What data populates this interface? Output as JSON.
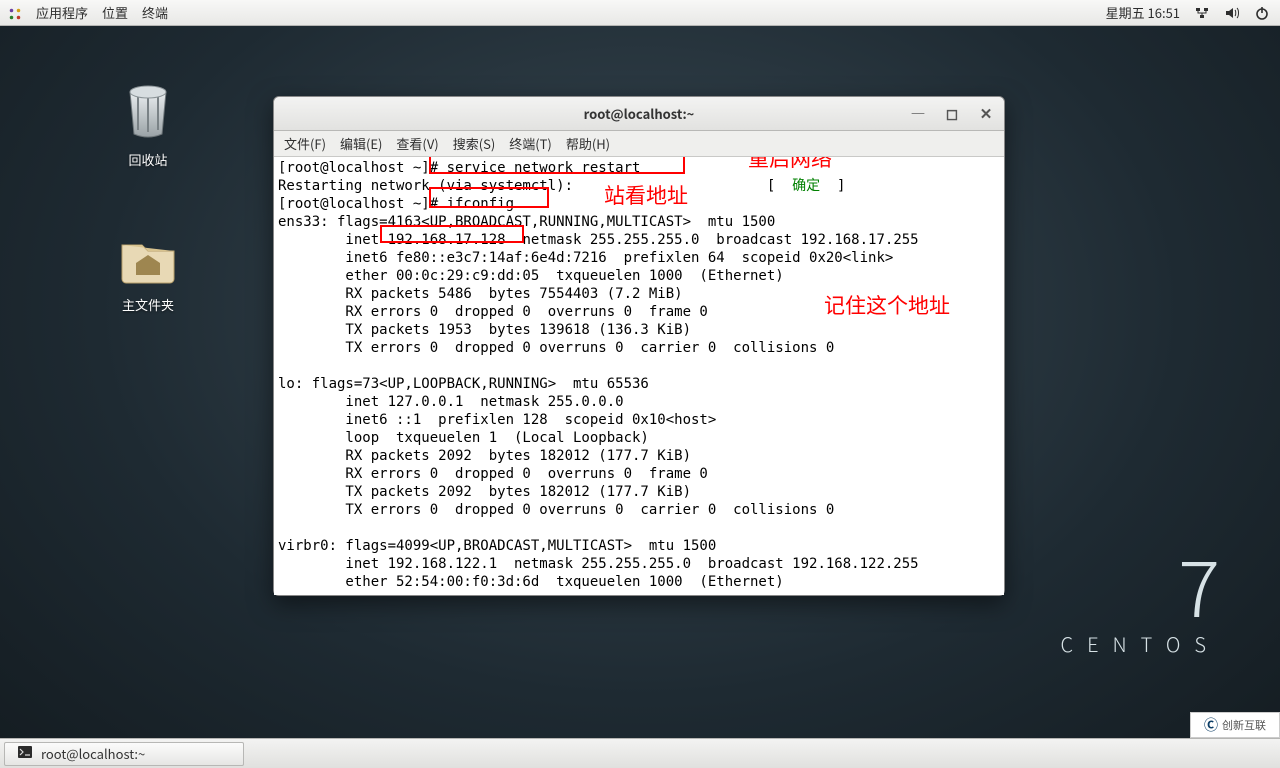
{
  "topbar": {
    "menus": [
      "应用程序",
      "位置",
      "终端"
    ],
    "clock": "星期五 16:51"
  },
  "desktop": {
    "trash_label": "回收站",
    "home_label": "主文件夹"
  },
  "centos": {
    "seven": "7",
    "word": "CENTOS"
  },
  "taskbar": {
    "task_label": "root@localhost:~"
  },
  "window": {
    "title": "root@localhost:~",
    "menus": [
      "文件(F)",
      "编辑(E)",
      "查看(V)",
      "搜索(S)",
      "终端(T)",
      "帮助(H)"
    ]
  },
  "annotations": {
    "restart": "重启网络",
    "view_ip": "站看地址",
    "remember": "记住这个地址",
    "ok": "确定"
  },
  "terminal": {
    "line1_prompt": "[root@localhost ~]",
    "line1_cmd": "# service network restart",
    "line2_a": "Restarting network (via systemctl):",
    "line2_b": "                       [  ",
    "line2_c": "  ]",
    "line3_prompt": "[root@localhost ~]",
    "line3_cmd": "# ifconfig",
    "ens_head": "ens33: flags=4163<UP,BROADCAST,RUNNING,MULTICAST>  mtu 1500",
    "ens_inet_a": "        inet ",
    "ens_inet_ip": "192.168.17.128",
    "ens_inet_b": "  netmask 255.255.255.0  broadcast 192.168.17.255",
    "ens_inet6": "        inet6 fe80::e3c7:14af:6e4d:7216  prefixlen 64  scopeid 0x20<link>",
    "ens_ether": "        ether 00:0c:29:c9:dd:05  txqueuelen 1000  (Ethernet)",
    "ens_rx1": "        RX packets 5486  bytes 7554403 (7.2 MiB)",
    "ens_rx2": "        RX errors 0  dropped 0  overruns 0  frame 0",
    "ens_tx1": "        TX packets 1953  bytes 139618 (136.3 KiB)",
    "ens_tx2": "        TX errors 0  dropped 0 overruns 0  carrier 0  collisions 0",
    "lo_head": "lo: flags=73<UP,LOOPBACK,RUNNING>  mtu 65536",
    "lo_inet": "        inet 127.0.0.1  netmask 255.0.0.0",
    "lo_inet6": "        inet6 ::1  prefixlen 128  scopeid 0x10<host>",
    "lo_loop": "        loop  txqueuelen 1  (Local Loopback)",
    "lo_rx1": "        RX packets 2092  bytes 182012 (177.7 KiB)",
    "lo_rx2": "        RX errors 0  dropped 0  overruns 0  frame 0",
    "lo_tx1": "        TX packets 2092  bytes 182012 (177.7 KiB)",
    "lo_tx2": "        TX errors 0  dropped 0 overruns 0  carrier 0  collisions 0",
    "vb_head": "virbr0: flags=4099<UP,BROADCAST,MULTICAST>  mtu 1500",
    "vb_inet": "        inet 192.168.122.1  netmask 255.255.255.0  broadcast 192.168.122.255",
    "vb_ether": "        ether 52:54:00:f0:3d:6d  txqueuelen 1000  (Ethernet)"
  },
  "watermark": "创新互联"
}
